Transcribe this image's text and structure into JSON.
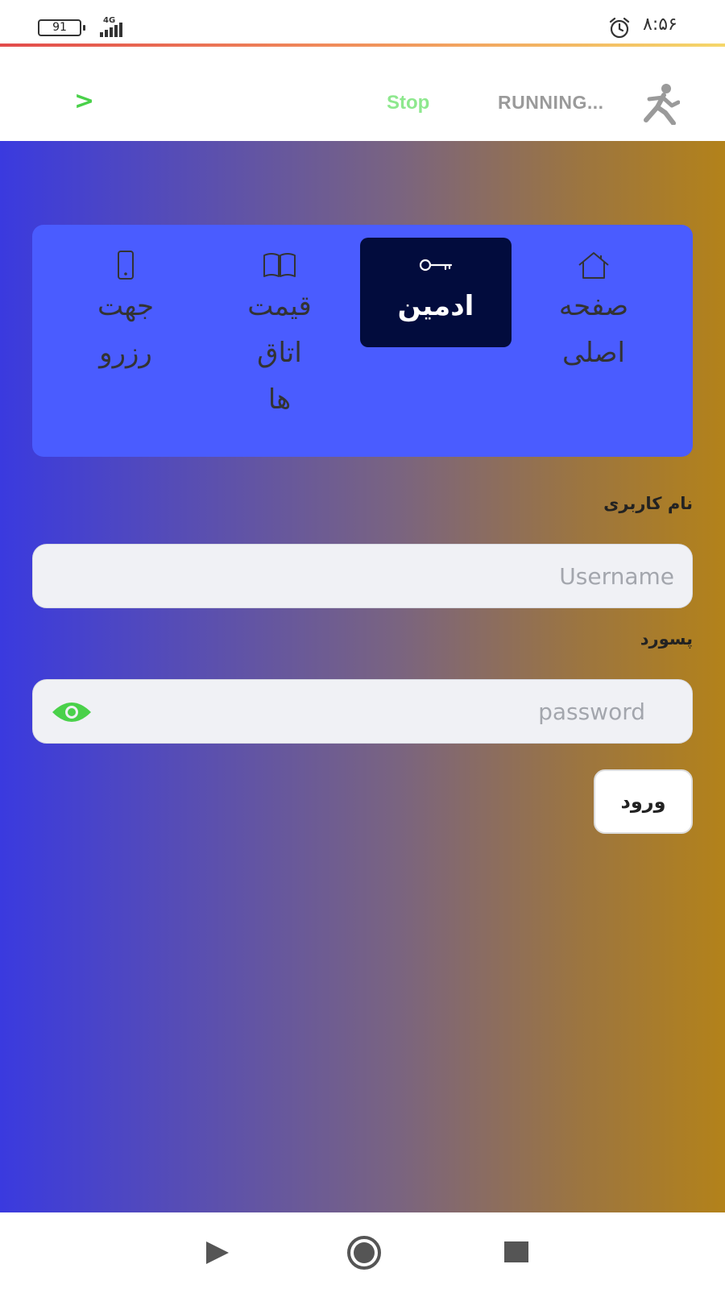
{
  "status_bar": {
    "battery_level": "91",
    "network_type": "4G",
    "time": "۸:۵۶",
    "icons": [
      "battery-icon",
      "signal-icon",
      "alarm-icon"
    ]
  },
  "app_bar": {
    "back_icon": "chevron-icon",
    "stop_label": "Stop",
    "running_label": "RUNNING...",
    "runner_icon": "runner-icon",
    "accent_color": "#4ad14a"
  },
  "nav": {
    "items": [
      {
        "icon": "phone-icon",
        "label_line1": "جهت",
        "label_line2": "رزرو",
        "label_line3": ""
      },
      {
        "icon": "book-icon",
        "label_line1": "قیمت",
        "label_line2": "اتاق",
        "label_line3": "ها"
      },
      {
        "icon": "key-icon",
        "label_line1": "ادمین",
        "label_line2": "",
        "label_line3": "",
        "active": true
      },
      {
        "icon": "home-icon",
        "label_line1": "صفحه",
        "label_line2": "اصلی",
        "label_line3": ""
      }
    ],
    "card_color": "#4a5cff",
    "active_color": "#020c3d"
  },
  "form": {
    "username_label": "نام کاربری",
    "username_value": "",
    "username_placeholder": "Username",
    "password_label": "پسورد",
    "password_value": "",
    "password_placeholder": "password",
    "eye_icon": "eye-icon",
    "eye_color": "#4ad14a",
    "submit_label": "ورود"
  },
  "system_nav": {
    "icons": [
      "back-triangle-icon",
      "home-circle-icon",
      "recents-square-icon"
    ]
  }
}
